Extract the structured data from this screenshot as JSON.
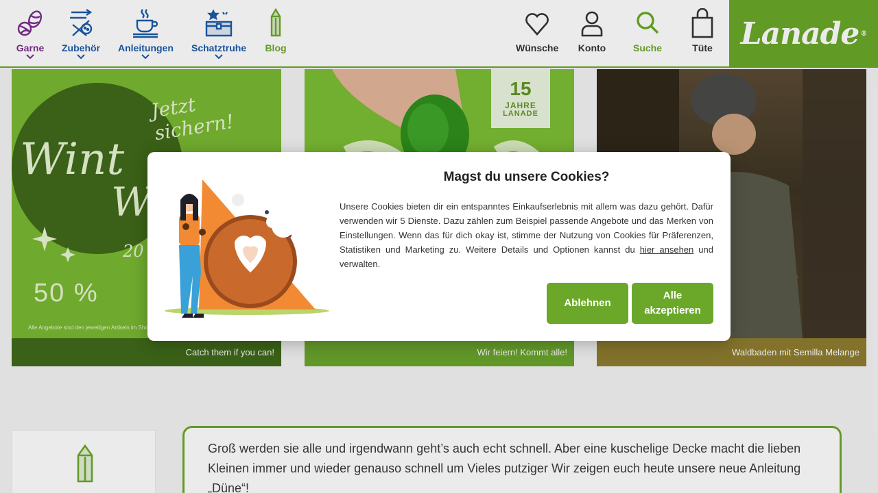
{
  "header": {
    "nav": [
      {
        "label": "Garne",
        "icon": "yarn-icon"
      },
      {
        "label": "Zubehör",
        "icon": "accessories-icon"
      },
      {
        "label": "Anleitungen",
        "icon": "instructions-icon"
      },
      {
        "label": "Schatztruhe",
        "icon": "treasure-chest-icon"
      },
      {
        "label": "Blog",
        "icon": "pencil-icon"
      }
    ],
    "actions": [
      {
        "label": "Wünsche",
        "icon": "heart-icon"
      },
      {
        "label": "Konto",
        "icon": "user-icon"
      },
      {
        "label": "Suche",
        "icon": "search-icon"
      },
      {
        "label": "Tüte",
        "icon": "bag-icon"
      }
    ],
    "logo": "Lanade",
    "logo_mark": "®",
    "colors": {
      "brand_green": "#6ba82a",
      "purple": "#7a2d8c",
      "blue": "#1d5ba8"
    }
  },
  "tiles": [
    {
      "caption": "Catch them if you can!",
      "image_text": {
        "tagline": "Jetzt sichern!",
        "word1": "Wint",
        "word2": "W",
        "year": "20",
        "percent": "50 %",
        "fineprint": "Alle Angebote sind den jeweiligen Artikeln im Sho"
      }
    },
    {
      "caption": "Wir feiern! Kommt alle!",
      "image_text": {
        "badge_number": "15",
        "badge_label1": "JAHRE",
        "badge_label2": "LANADE"
      }
    },
    {
      "caption": "Waldbaden mit Semilla Melange"
    }
  ],
  "cookie_dialog": {
    "title": "Magst du unsere Cookies?",
    "body": "Unsere Cookies bieten dir ein entspanntes Einkaufserlebnis mit allem was dazu gehört. Dafür verwenden wir 5 Dienste. Dazu zählen zum Beispiel passende Angebote und das Merken von Einstellungen. Wenn das für dich okay ist, stimme der Nutzung von Cookies für Präferenzen, Statistiken und Marketing zu. Weitere Details und Optionen kannst du ",
    "link": "hier ansehen",
    "body_end": " und verwalten.",
    "decline": "Ablehnen",
    "accept": "Alle akzeptieren"
  },
  "content": {
    "paragraph": "Groß werden sie alle und irgendwann geht’s auch echt schnell. Aber eine kuschelige Decke macht die lieben Kleinen immer und wieder genauso schnell um Vieles putziger    Wir zeigen euch heute unsere neue Anleitung „Düne“!"
  }
}
